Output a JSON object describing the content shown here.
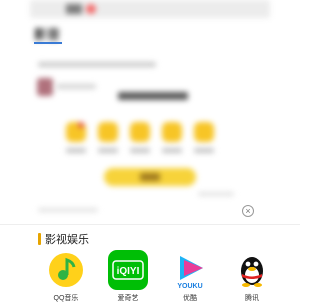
{
  "header": {
    "tab_label": "影音"
  },
  "section": {
    "title": "影视娱乐"
  },
  "apps": [
    {
      "name": "QQ音乐",
      "icon": "qq-music-icon"
    },
    {
      "name": "爱奇艺",
      "icon": "iqiyi-icon",
      "logo_text": "iQIYI"
    },
    {
      "name": "优酷",
      "icon": "youku-icon",
      "logo_text": "YOUKU"
    },
    {
      "name": "腾讯",
      "icon": "qq-penguin-icon"
    }
  ],
  "close_glyph": "×",
  "colors": {
    "accent_yellow": "#f7d33a",
    "iqiyi_green": "#00be06",
    "section_bar": "#e6a400",
    "tab_underline": "#3a7bd5"
  }
}
